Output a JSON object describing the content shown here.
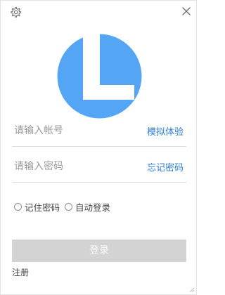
{
  "window": {
    "settings_icon": "gear-icon",
    "close_icon": "close-icon"
  },
  "logo": {
    "icon": "app-logo-L",
    "color": "#55A5F5"
  },
  "account": {
    "placeholder": "请输入帐号",
    "value": "",
    "link_label": "模拟体验"
  },
  "password": {
    "placeholder": "请输入密码",
    "value": "",
    "link_label": "忘记密码"
  },
  "options": {
    "remember_label": "记住密码",
    "remember_checked": false,
    "auto_login_label": "自动登录",
    "auto_login_checked": false
  },
  "login_button_label": "登录",
  "register_label": "注册",
  "colors": {
    "accent_link": "#2F7DD3",
    "button_disabled": "#D3D3D3"
  }
}
